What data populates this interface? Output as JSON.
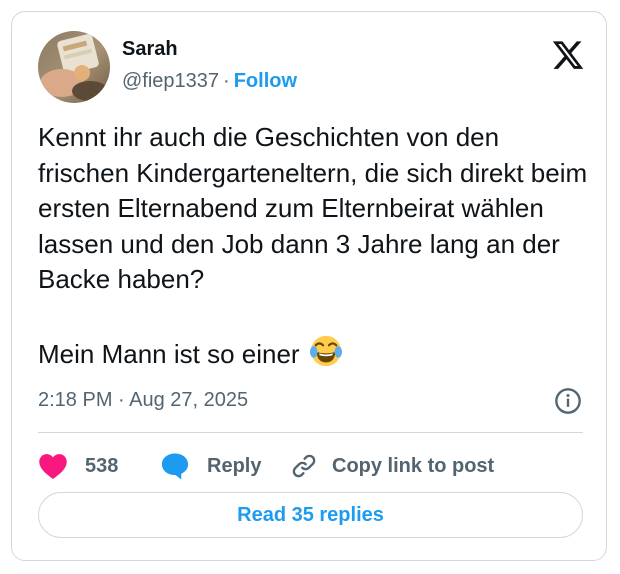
{
  "author": {
    "name": "Sarah",
    "handle": "@fiep1337",
    "separator": "·",
    "follow_label": "Follow"
  },
  "tweet": {
    "paragraph_1": "Kennt ihr auch die Geschichten von den frischen Kindergarteneltern, die sich direkt beim ersten Elternabend zum Elternbeirat wählen lassen und den Job dann 3 Jahre lang an der Backe haben?",
    "paragraph_2": "Mein Mann ist so einer",
    "emoji": "face-with-tears-of-joy"
  },
  "meta": {
    "timestamp": "2:18 PM · Aug 27, 2025"
  },
  "actions": {
    "like_count": "538",
    "reply_label": "Reply",
    "copy_link_label": "Copy link to post"
  },
  "footer": {
    "read_replies_label": "Read 35 replies"
  },
  "icons": {
    "platform": "x-logo-icon",
    "info": "info-icon",
    "like": "heart-icon",
    "reply": "reply-bubble-icon",
    "copy": "link-icon"
  },
  "colors": {
    "accent": "#1d9bf0",
    "like": "#f91880",
    "text": "#0f1419",
    "secondary_text": "#536471",
    "border": "#cfd9de"
  }
}
